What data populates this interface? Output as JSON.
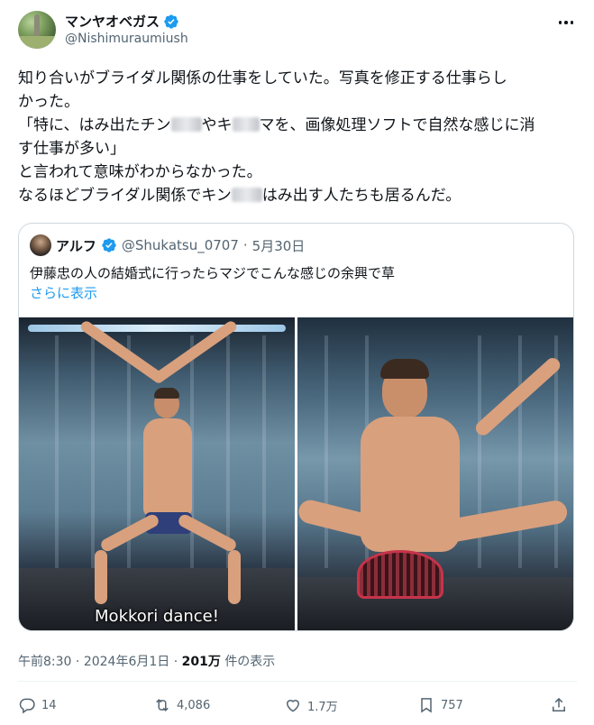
{
  "author": {
    "display_name": "マンヤオベガス",
    "handle": "@Nishimuraumiush"
  },
  "tweet": {
    "line1": "知り合いがブライダル関係の仕事をしていた。写真を修正する仕事らし",
    "line2": "かった。",
    "line3_a": "「特に、はみ出たチン",
    "line3_b": "やキ",
    "line3_c": "マを、画像処理ソフトで自然な感じに消",
    "line4": "す仕事が多い」",
    "line5": "と言われて意味がわからなかった。",
    "line6_a": "なるほどブライダル関係でキン",
    "line6_b": "はみ出す人たちも居るんだ。"
  },
  "quote": {
    "display_name": "アルフ",
    "handle": "@Shukatsu_0707",
    "separator": "·",
    "date": "5月30日",
    "text": "伊藤忠の人の結婚式に行ったらマジでこんな感じの余興で草",
    "show_more": "さらに表示",
    "photo_caption": "Mokkori dance!"
  },
  "meta": {
    "time": "午前8:30",
    "sep": "·",
    "date": "2024年6月1日",
    "views_count": "201万",
    "views_label": "件の表示"
  },
  "actions": {
    "replies": "14",
    "reposts": "4,086",
    "likes": "1.7万",
    "bookmarks": "757"
  },
  "colors": {
    "verified": "#1d9bf0",
    "link": "#1d9bf0",
    "secondary_text": "#536471"
  }
}
